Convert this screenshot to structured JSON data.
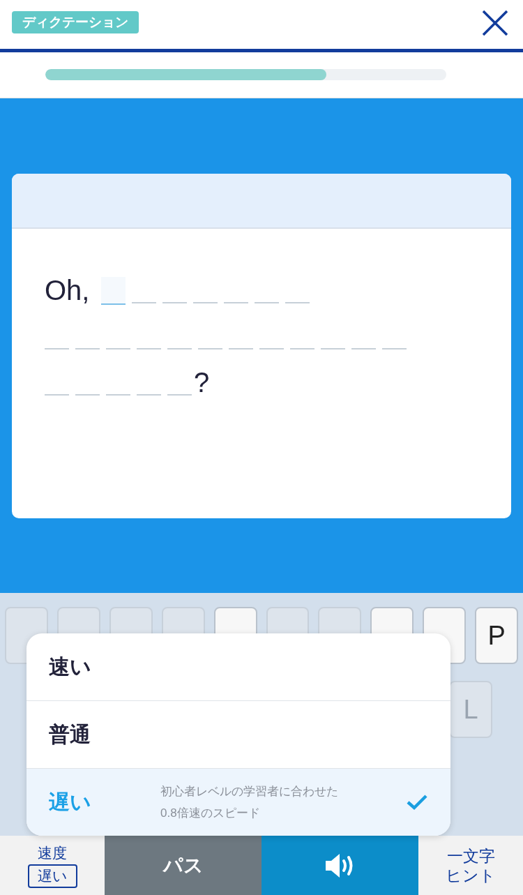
{
  "header": {
    "badge": "ディクテーション"
  },
  "progress": {
    "level": 0.7
  },
  "exercise": {
    "lines": [
      {
        "items": [
          {
            "kind": "text",
            "text": "Oh,"
          },
          {
            "kind": "blank",
            "selected": true
          },
          {
            "kind": "blank",
            "selected": false
          },
          {
            "kind": "blank",
            "selected": false
          },
          {
            "kind": "blank",
            "selected": false
          },
          {
            "kind": "blank",
            "selected": false
          },
          {
            "kind": "blank",
            "selected": false
          },
          {
            "kind": "blank",
            "selected": false
          }
        ]
      },
      {
        "items": [
          {
            "kind": "blank",
            "selected": false
          },
          {
            "kind": "blank",
            "selected": false
          },
          {
            "kind": "blank",
            "selected": false
          },
          {
            "kind": "blank",
            "selected": false
          },
          {
            "kind": "blank",
            "selected": false
          },
          {
            "kind": "blank",
            "selected": false
          },
          {
            "kind": "blank",
            "selected": false
          },
          {
            "kind": "blank",
            "selected": false
          },
          {
            "kind": "blank",
            "selected": false
          },
          {
            "kind": "blank",
            "selected": false
          },
          {
            "kind": "blank",
            "selected": false
          },
          {
            "kind": "blank",
            "selected": false
          }
        ]
      },
      {
        "items": [
          {
            "kind": "blank",
            "selected": false
          },
          {
            "kind": "blank",
            "selected": false
          },
          {
            "kind": "blank",
            "selected": false
          },
          {
            "kind": "blank",
            "selected": false
          },
          {
            "kind": "blank",
            "selected": false
          },
          {
            "kind": "text",
            "text": "?"
          }
        ]
      }
    ]
  },
  "keyboard": {
    "rows": [
      {
        "keys": [
          {
            "disabled": true
          },
          {
            "disabled": true
          },
          {
            "disabled": true
          },
          {
            "disabled": true
          },
          {
            "disabled": false
          },
          {
            "disabled": true
          },
          {
            "disabled": true
          },
          {
            "disabled": false
          },
          {
            "disabled": false
          },
          {
            "disabled": false,
            "label": "P"
          }
        ]
      },
      {
        "keys": [
          {
            "disabled": true,
            "label": "L"
          }
        ]
      }
    ]
  },
  "speed_menu": {
    "options": [
      {
        "label": "速い",
        "selected": false
      },
      {
        "label": "普通",
        "selected": false
      },
      {
        "label": "遅い",
        "description": "初心者レベルの学習者に合わせた\n0.8倍速のスピード",
        "selected": true
      }
    ]
  },
  "bottom_bar": {
    "speed": {
      "label": "速度",
      "value": "遅い"
    },
    "pass": "パス",
    "hint": "一文字ヒント"
  }
}
